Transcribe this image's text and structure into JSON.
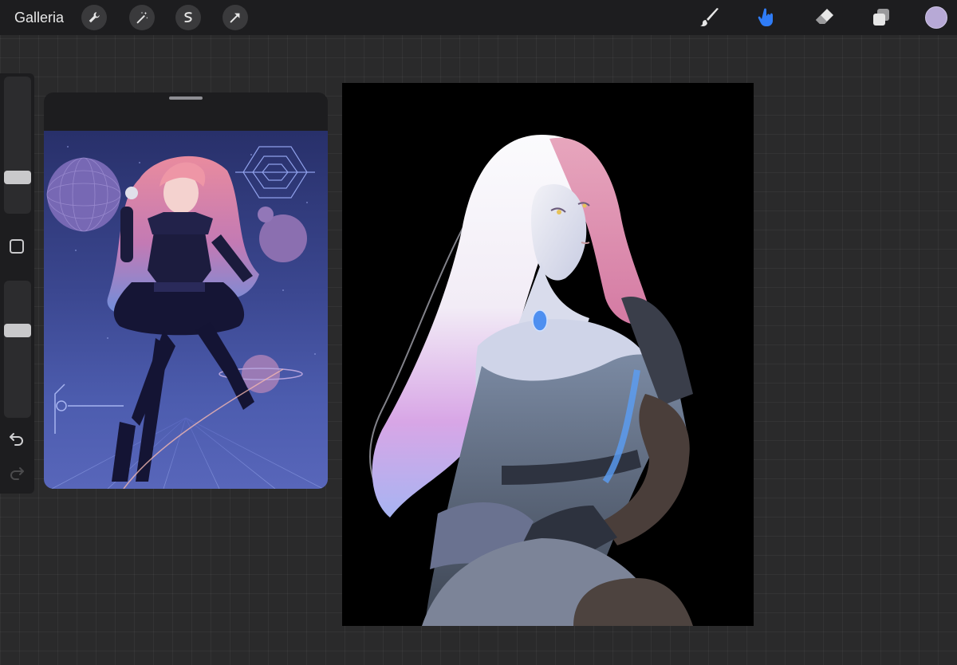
{
  "topbar": {
    "gallery_label": "Galleria",
    "left_tools": [
      "wrench-icon",
      "magic-wand-icon",
      "selection-icon",
      "transform-arrow-icon"
    ],
    "right_tools": [
      "brush-icon",
      "smudge-icon",
      "eraser-icon",
      "layers-icon"
    ],
    "active_tool": "smudge-icon",
    "active_color": "#b7a9d6",
    "accent_color": "#2f7cf6"
  },
  "sidebar": {
    "controls": [
      "brush-size-slider",
      "modify-button",
      "opacity-slider",
      "undo-button",
      "redo-button"
    ],
    "brush_size": 0.3,
    "opacity": 0.65
  },
  "reference": {
    "content": "anime-girl-idol-artwork"
  },
  "canvas": {
    "content": "pale-long-haired-woman-in-black-dress"
  }
}
